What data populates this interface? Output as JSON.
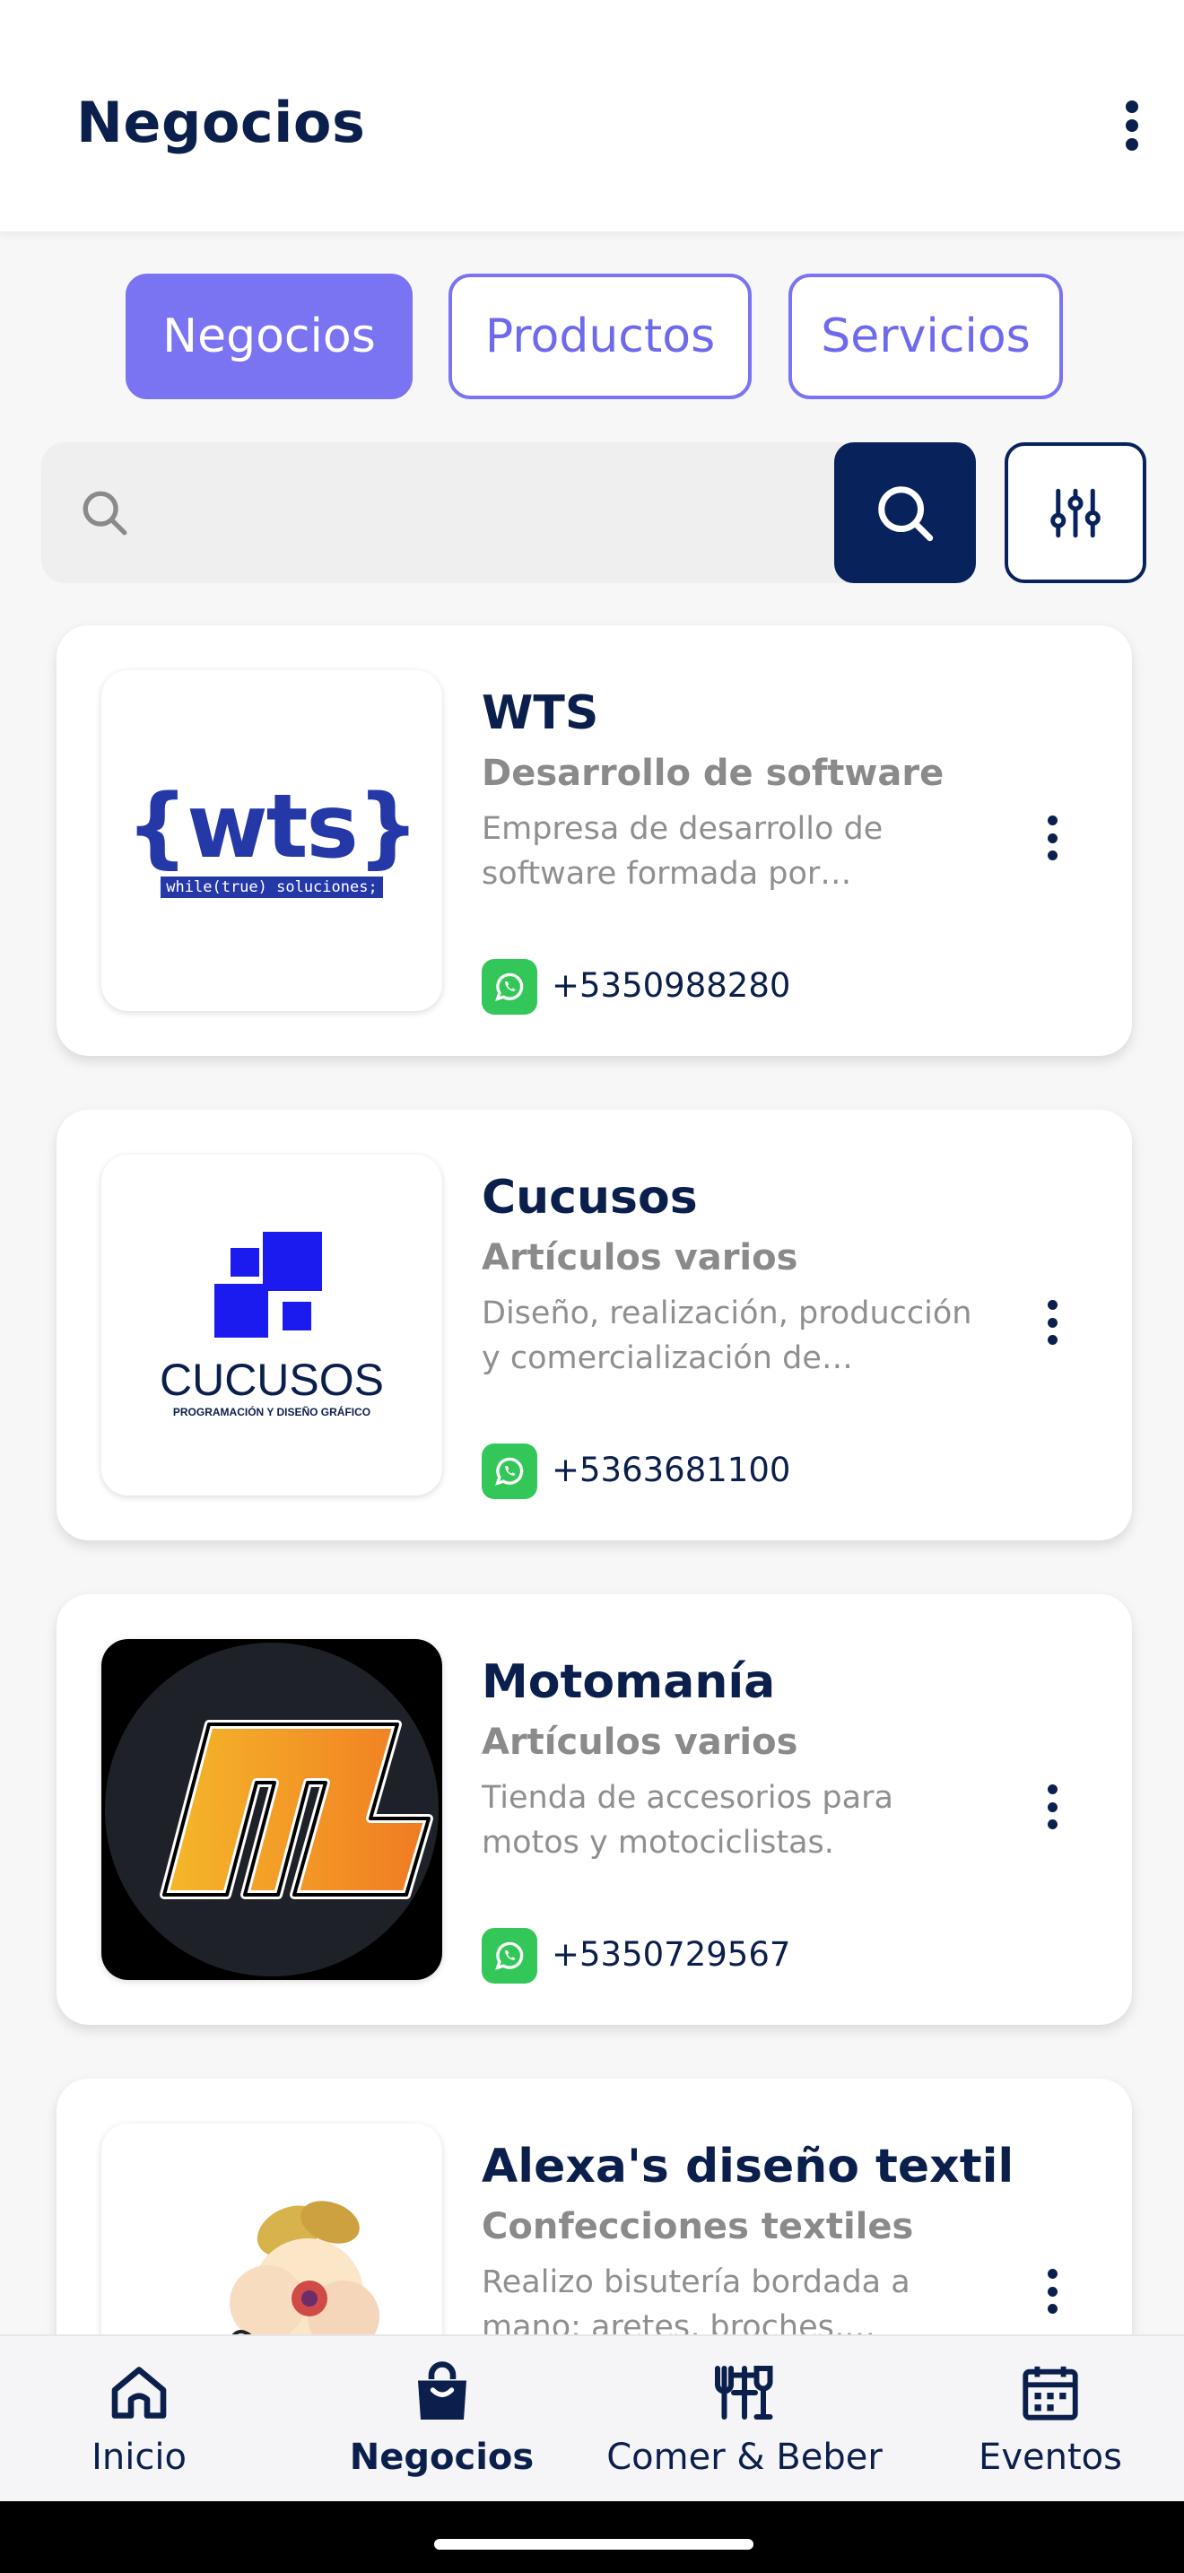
{
  "app_bar": {
    "title": "Negocios",
    "menu_icon": "more-vert-icon"
  },
  "tabs": [
    {
      "label": "Negocios",
      "active": true
    },
    {
      "label": "Productos",
      "active": false
    },
    {
      "label": "Servicios",
      "active": false
    }
  ],
  "search": {
    "placeholder": "",
    "value": "",
    "search_icon": "search-icon",
    "filter_icon": "sliders-icon"
  },
  "businesses": [
    {
      "name": "WTS",
      "category": "Desarrollo de software",
      "description": "Empresa de desarrollo de software formada por profesionales",
      "phone": "+5350988280",
      "logo_text": "{wts}",
      "logo_tagline": "while(true) soluciones;"
    },
    {
      "name": "Cucusos",
      "category": "Artículos varios",
      "description": "Diseño, realización, producción y comercialización de productos relacionados",
      "phone": "+5363681100",
      "logo_text": "CUCUSOS",
      "logo_tagline": "PROGRAMACIÓN Y DISEÑO GRÁFICO"
    },
    {
      "name": "Motomanía",
      "category": "Artículos varios",
      "description": "Tienda de accesorios para motos y motociclistas.",
      "phone": "+5350729567",
      "logo_text": "ML"
    },
    {
      "name": "Alexa's diseño textil",
      "category": "Confecciones textiles",
      "description": "Realizo bisutería bordada a mano: aretes, broches, colgantes",
      "phone": ""
    }
  ],
  "bottom_nav": [
    {
      "label": "Inicio",
      "icon": "home-icon",
      "active": false
    },
    {
      "label": "Negocios",
      "icon": "shopping-bag-icon",
      "active": true
    },
    {
      "label": "Comer & Beber",
      "icon": "restaurant-icon",
      "active": false
    },
    {
      "label": "Eventos",
      "icon": "calendar-icon",
      "active": false
    }
  ],
  "colors": {
    "primary": "#0b1f4d",
    "accent": "#7a73f2",
    "whatsapp": "#33c759"
  }
}
